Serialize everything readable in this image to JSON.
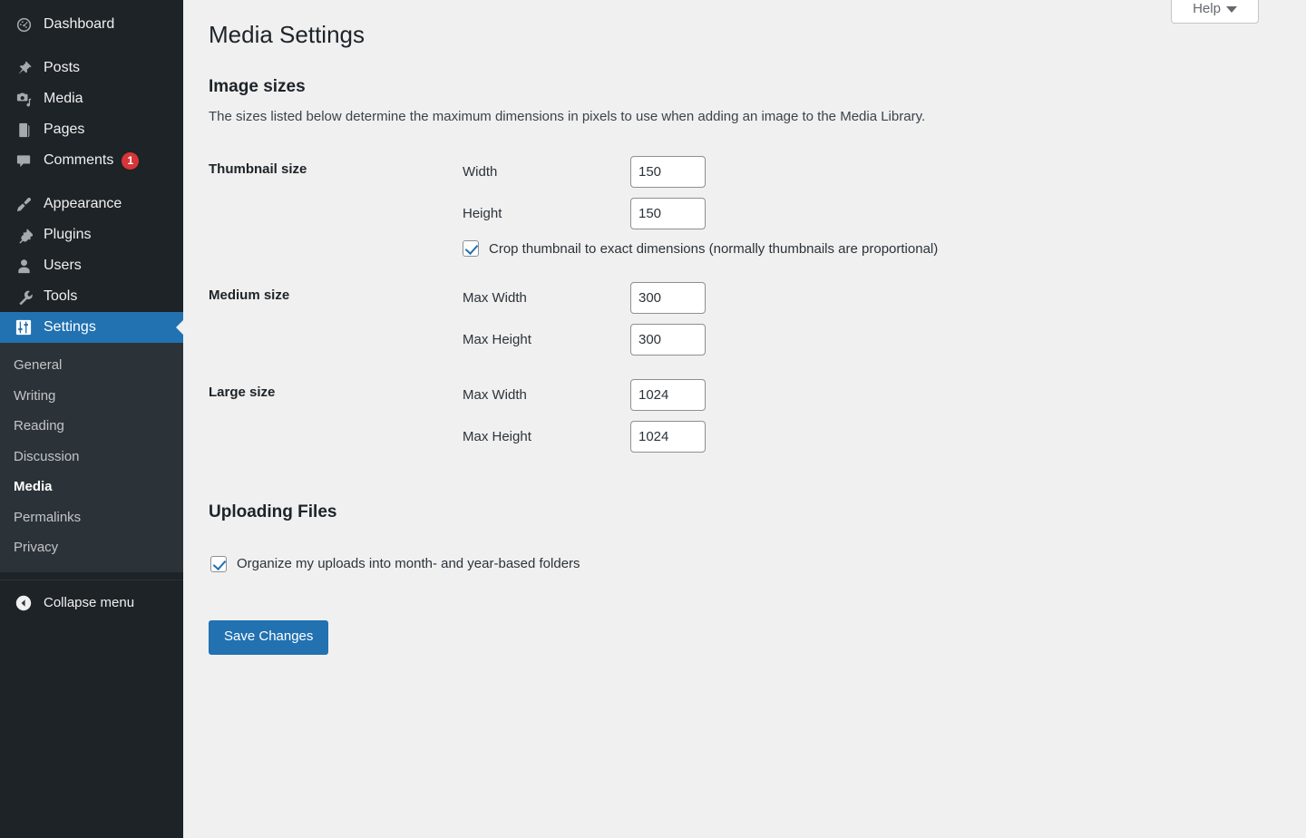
{
  "sidebar": {
    "items": [
      {
        "label": "Dashboard",
        "icon": "dashboard-icon",
        "badge": null
      },
      {
        "label": "Posts",
        "icon": "pin-icon",
        "badge": null
      },
      {
        "label": "Media",
        "icon": "camera-icon",
        "badge": null
      },
      {
        "label": "Pages",
        "icon": "page-icon",
        "badge": null
      },
      {
        "label": "Comments",
        "icon": "comment-icon",
        "badge": "1"
      },
      {
        "label": "Appearance",
        "icon": "brush-icon",
        "badge": null
      },
      {
        "label": "Plugins",
        "icon": "plug-icon",
        "badge": null
      },
      {
        "label": "Users",
        "icon": "user-icon",
        "badge": null
      },
      {
        "label": "Tools",
        "icon": "wrench-icon",
        "badge": null
      },
      {
        "label": "Settings",
        "icon": "sliders-icon",
        "badge": null
      }
    ],
    "submenu": [
      {
        "label": "General"
      },
      {
        "label": "Writing"
      },
      {
        "label": "Reading"
      },
      {
        "label": "Discussion"
      },
      {
        "label": "Media"
      },
      {
        "label": "Permalinks"
      },
      {
        "label": "Privacy"
      }
    ],
    "collapse_label": "Collapse menu"
  },
  "help": {
    "label": "Help"
  },
  "page": {
    "title": "Media Settings"
  },
  "image_sizes": {
    "heading": "Image sizes",
    "description": "The sizes listed below determine the maximum dimensions in pixels to use when adding an image to the Media Library.",
    "thumbnail": {
      "row_label": "Thumbnail size",
      "width_label": "Width",
      "width_value": "150",
      "height_label": "Height",
      "height_value": "150",
      "crop_label": "Crop thumbnail to exact dimensions (normally thumbnails are proportional)",
      "crop_checked": true
    },
    "medium": {
      "row_label": "Medium size",
      "width_label": "Max Width",
      "width_value": "300",
      "height_label": "Max Height",
      "height_value": "300"
    },
    "large": {
      "row_label": "Large size",
      "width_label": "Max Width",
      "width_value": "1024",
      "height_label": "Max Height",
      "height_value": "1024"
    }
  },
  "uploading_files": {
    "heading": "Uploading Files",
    "organize_label": "Organize my uploads into month- and year-based folders",
    "organize_checked": true
  },
  "actions": {
    "save_label": "Save Changes"
  },
  "colors": {
    "sidebar_bg": "#1d2327",
    "submenu_bg": "#2c3338",
    "accent_blue": "#2271b1",
    "page_bg": "#f0f0f1",
    "badge_red": "#d63638"
  }
}
